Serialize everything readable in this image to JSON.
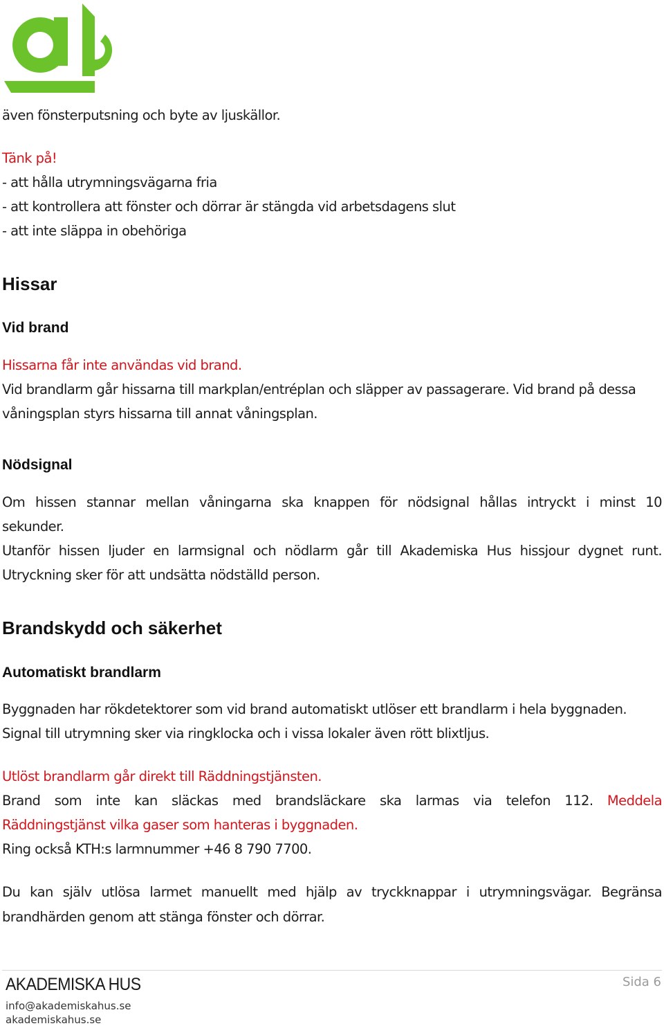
{
  "brand": {
    "logo_name": "ah-logo",
    "color": "#6cc22b"
  },
  "intro": {
    "line": "även fönsterputsning och byte av ljuskällor."
  },
  "reminder": {
    "title": "Tänk på!",
    "items": [
      "- att hålla utrymningsvägarna fria",
      "- att kontrollera att fönster och dörrar är stängda vid arbetsdagens slut",
      "- att inte släppa in obehöriga"
    ]
  },
  "elevators": {
    "heading": "Hissar",
    "fire": {
      "heading": "Vid brand",
      "warning": "Hissarna får inte användas vid brand.",
      "text": "Vid brandlarm går hissarna till markplan/entréplan och släpper av passagerare. Vid brand på dessa våningsplan styrs hissarna till annat våningsplan.",
      "line1": "Vid brandlarm går hissarna till markplan/entréplan och släpper av passagerare. Vid brand på dessa",
      "line2": "våningsplan styrs hissarna till annat våningsplan."
    },
    "emergency": {
      "heading": "Nödsignal",
      "p1_line1": "Om hissen stannar mellan våningarna ska knappen för nödsignal hållas intryckt i minst 10",
      "p1_line2": "sekunder.",
      "p2_line1": "Utanför hissen ljuder en larmsignal och nödlarm går till Akademiska Hus hissjour dygnet runt.",
      "p2_line2": "Utryckning sker för att undsätta nödställd person."
    }
  },
  "fire_safety": {
    "heading": "Brandskydd och säkerhet",
    "auto_alarm": {
      "heading": "Automatiskt brandlarm",
      "p1_line1": "Byggnaden har rökdetektorer som vid brand automatiskt utlöser ett brandlarm i hela byggnaden.",
      "p1_line2": "Signal till utrymning sker via ringklocka och i vissa lokaler även rött blixtljus.",
      "alert": "Utlöst brandlarm går direkt till Räddningstjänsten.",
      "p2_line1_black": "Brand som inte kan släckas med brandsläckare ska larmas via telefon 112.",
      "p2_line1_red": "Meddela",
      "p2_line2_red": "Räddningstjänst vilka gaser som hanteras i byggnaden.",
      "kth_line": "Ring också KTH:s larmnummer +46 8 790 7700.",
      "p3_line1": "Du kan själv utlösa larmet manuellt med hjälp av tryckknappar i utrymningsvägar. Begränsa",
      "p3_line2": "brandhärden genom att stänga fönster och dörrar."
    }
  },
  "footer": {
    "company": "AKADEMISKA HUS",
    "email": "info@akademiskahus.se",
    "website": "akademiskahus.se",
    "page": "Sida 6"
  }
}
